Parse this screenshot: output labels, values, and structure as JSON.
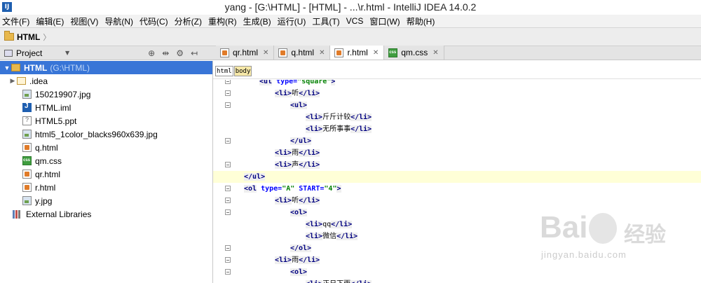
{
  "window": {
    "title": "yang - [G:\\HTML] - [HTML] - ...\\r.html - IntelliJ IDEA 14.0.2",
    "logo_text": "IJ"
  },
  "menu": [
    "文件(F)",
    "编辑(E)",
    "视图(V)",
    "导航(N)",
    "代码(C)",
    "分析(Z)",
    "重构(R)",
    "生成(B)",
    "运行(U)",
    "工具(T)",
    "VCS",
    "窗口(W)",
    "帮助(H)"
  ],
  "navbar": {
    "label": "HTML"
  },
  "project_panel": {
    "title": "Project",
    "tools": [
      "⊕",
      "⇹",
      "⚙",
      "↤"
    ],
    "tree": [
      {
        "label": "HTML",
        "sub": "(G:\\HTML)",
        "icon": "folder-icon",
        "arrow": "▼",
        "indent": 0,
        "selected": true
      },
      {
        "label": ".idea",
        "icon": "folder-plain-icon",
        "arrow": "▶",
        "indent": 1
      },
      {
        "label": "150219907.jpg",
        "icon": "image-file-icon",
        "indent": 2
      },
      {
        "label": "HTML.iml",
        "icon": "iml-file-icon",
        "indent": 2
      },
      {
        "label": "HTML5.ppt",
        "icon": "unknown-file-icon",
        "indent": 2
      },
      {
        "label": "html5_1color_blacks960x639.jpg",
        "icon": "image-file-icon",
        "indent": 2
      },
      {
        "label": "q.html",
        "icon": "html-file-icon",
        "indent": 2
      },
      {
        "label": "qm.css",
        "icon": "css-file-icon",
        "indent": 2
      },
      {
        "label": "qr.html",
        "icon": "html-file-icon",
        "indent": 2
      },
      {
        "label": "r.html",
        "icon": "html-file-icon",
        "indent": 2
      },
      {
        "label": "y.jpg",
        "icon": "image-file-icon",
        "indent": 2
      },
      {
        "label": "External Libraries",
        "icon": "libraries-icon",
        "indent": 0
      }
    ]
  },
  "tabs": [
    {
      "label": "qr.html",
      "icon": "html-file-icon",
      "active": false
    },
    {
      "label": "q.html",
      "icon": "html-file-icon",
      "active": false
    },
    {
      "label": "r.html",
      "icon": "html-file-icon",
      "active": true
    },
    {
      "label": "qm.css",
      "icon": "css-file-icon",
      "active": false
    }
  ],
  "breadcrumbs": [
    "html",
    "body"
  ],
  "code_lines": [
    {
      "indent": 2,
      "fold": true,
      "parts": [
        [
          "tg",
          "<ul"
        ],
        [
          "at",
          " type="
        ],
        [
          "av",
          "\"square\""
        ],
        [
          "tg",
          ">"
        ]
      ]
    },
    {
      "indent": 4,
      "fold": true,
      "parts": [
        [
          "tg",
          "<li>"
        ],
        [
          "tx",
          "听"
        ],
        [
          "tg",
          "</li>"
        ]
      ]
    },
    {
      "indent": 6,
      "fold": true,
      "parts": [
        [
          "tg",
          "<ul>"
        ]
      ]
    },
    {
      "indent": 8,
      "fold": false,
      "parts": [
        [
          "tg",
          "<li>"
        ],
        [
          "tx",
          "斤斤计较"
        ],
        [
          "tg",
          "</li>"
        ]
      ]
    },
    {
      "indent": 8,
      "fold": false,
      "parts": [
        [
          "tg",
          "<li>"
        ],
        [
          "tx",
          "无所事事"
        ],
        [
          "tg",
          "</li>"
        ]
      ]
    },
    {
      "indent": 6,
      "fold": true,
      "parts": [
        [
          "tg",
          "</ul>"
        ]
      ]
    },
    {
      "indent": 4,
      "fold": false,
      "parts": [
        [
          "tg",
          "<li>"
        ],
        [
          "tx",
          "雨"
        ],
        [
          "tg",
          "</li>"
        ]
      ]
    },
    {
      "indent": 4,
      "fold": true,
      "parts": [
        [
          "tg",
          "<li>"
        ],
        [
          "tx",
          "声"
        ],
        [
          "tg",
          "</li>"
        ]
      ]
    },
    {
      "indent": 0,
      "fold": false,
      "current": true,
      "parts": [
        [
          "tg",
          "</ul>"
        ]
      ]
    },
    {
      "indent": 0,
      "fold": true,
      "parts": [
        [
          "tg",
          "<ol"
        ],
        [
          "at",
          " type="
        ],
        [
          "av",
          "\"A\""
        ],
        [
          "at",
          " START="
        ],
        [
          "av",
          "\"4\""
        ],
        [
          "tg",
          ">"
        ]
      ]
    },
    {
      "indent": 4,
      "fold": true,
      "parts": [
        [
          "tg",
          "<li>"
        ],
        [
          "tx",
          "听"
        ],
        [
          "tg",
          "</li>"
        ]
      ]
    },
    {
      "indent": 6,
      "fold": true,
      "parts": [
        [
          "tg",
          "<ol>"
        ]
      ]
    },
    {
      "indent": 8,
      "fold": false,
      "parts": [
        [
          "tg",
          "<li>"
        ],
        [
          "tx",
          "qq"
        ],
        [
          "tg",
          "</li>"
        ]
      ]
    },
    {
      "indent": 8,
      "fold": false,
      "parts": [
        [
          "tg",
          "<li>"
        ],
        [
          "tx",
          "微信"
        ],
        [
          "tg",
          "</li>"
        ]
      ]
    },
    {
      "indent": 6,
      "fold": true,
      "parts": [
        [
          "tg",
          "</ol>"
        ]
      ]
    },
    {
      "indent": 4,
      "fold": true,
      "parts": [
        [
          "tg",
          "<li>"
        ],
        [
          "tx",
          "雨"
        ],
        [
          "tg",
          "</li>"
        ]
      ]
    },
    {
      "indent": 6,
      "fold": true,
      "parts": [
        [
          "tg",
          "<ol>"
        ]
      ]
    },
    {
      "indent": 8,
      "fold": false,
      "parts": [
        [
          "tg",
          "<li>"
        ],
        [
          "tx",
          "正日下雨"
        ],
        [
          "tg",
          "</li>"
        ]
      ]
    }
  ],
  "watermark": {
    "brand": "Bai",
    "cn": "经验",
    "sub": "jingyan.baidu.com"
  }
}
